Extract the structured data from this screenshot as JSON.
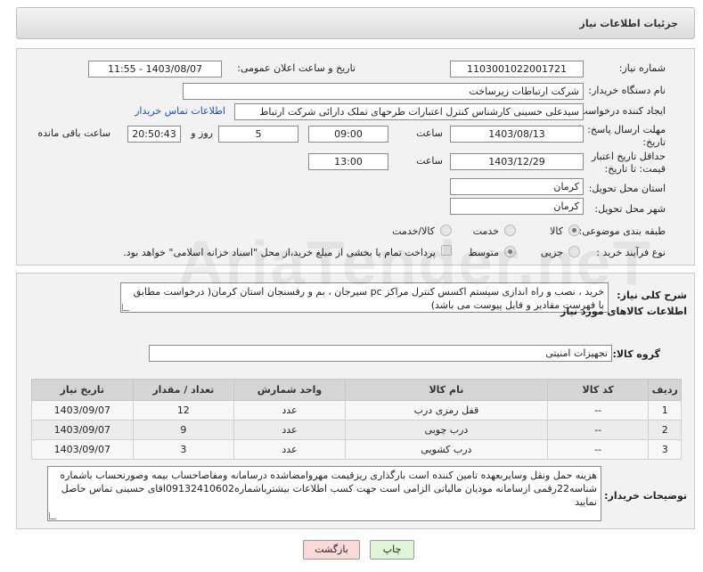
{
  "header": {
    "title": "جزئیات اطلاعات نیاز"
  },
  "form": {
    "need_number": {
      "label": "شماره نیاز:",
      "value": "1103001022001721"
    },
    "announce_datetime": {
      "label": "تاریخ و ساعت اعلان عمومی:",
      "value": "1403/08/07 - 11:55"
    },
    "buyer_org": {
      "label": "نام دستگاه خریدار:",
      "value": "شرکت ارتباطات زیرساخت"
    },
    "requester": {
      "label": "ایجاد کننده درخواست:",
      "value": "سیدعلی حسینی کارشناس کنترل اعتبارات طرحهای تملک دارائی شرکت ارتباط",
      "contact_link": "اطلاعات تماس خریدار"
    },
    "reply_deadline": {
      "label": "مهلت ارسال پاسخ: تا تاریخ:",
      "date": "1403/08/13",
      "time_label": "ساعت",
      "time": "09:00",
      "days": "5",
      "days_label": "روز و",
      "remaining": "20:50:43",
      "remaining_label": "ساعت باقی مانده"
    },
    "price_validity": {
      "label": "حداقل تاریخ اعتبار قیمت: تا تاریخ:",
      "date": "1403/12/29",
      "time_label": "ساعت",
      "time": "13:00"
    },
    "province": {
      "label": "استان محل تحویل:",
      "value": "کرمان"
    },
    "city": {
      "label": "شهر محل تحویل:",
      "value": "کرمان"
    },
    "category": {
      "label": "طبقه بندی موضوعی:",
      "options": [
        "کالا",
        "خدمت",
        "کالا/خدمت"
      ],
      "selected": "کالا"
    },
    "purchase_type": {
      "label": "نوع فرآیند خرید :",
      "options": [
        "جزیی",
        "متوسط"
      ],
      "selected": "متوسط",
      "payment_note": "پرداخت تمام یا بخشی از مبلغ خرید،از محل \"اسناد خزانه اسلامی\" خواهد بود."
    }
  },
  "description": {
    "label": "شرح کلی نیاز:",
    "value": "خرید ، نصب و راه اندازی سیستم اکسس کنترل مراکز pc سیرجان ، بم و رفسنجان استان کرمان( درخواست مطابق با فهرست مقادیر و فایل پیوست می باشد)"
  },
  "goods": {
    "section_title": "اطلاعات کالاهای مورد نیاز",
    "group_label": "گروه کالا:",
    "group_value": "تجهیزات امنیتی",
    "columns": [
      "ردیف",
      "کد کالا",
      "نام کالا",
      "واحد شمارش",
      "تعداد / مقدار",
      "تاریخ نیاز"
    ],
    "rows": [
      {
        "row": "1",
        "code": "--",
        "name": "قفل رمزی درب",
        "unit": "عدد",
        "qty": "12",
        "date": "1403/09/07"
      },
      {
        "row": "2",
        "code": "--",
        "name": "درب چوبی",
        "unit": "عدد",
        "qty": "9",
        "date": "1403/09/07"
      },
      {
        "row": "3",
        "code": "--",
        "name": "درب کشویی",
        "unit": "عدد",
        "qty": "3",
        "date": "1403/09/07"
      }
    ]
  },
  "buyer_notes": {
    "label": "توضیحات خریدار:",
    "value": "هزینه حمل ونقل وسایربعهده تامین کننده است بارگذاری ریزقیمت مهروامضاشده درسامانه ومفاصاحساب بیمه وصورتحساب باشماره شناسه22رقمی ازسامانه مودیان مالیاتی الزامی است جهت کسب اطلاعات بیشترباشماره09132410602اقای حسینی تماس حاصل نمایید"
  },
  "buttons": {
    "print": "چاپ",
    "back": "بازگشت"
  },
  "colors": {
    "link": "#1a55a8",
    "print_bg": "#dff5d8",
    "back_bg": "#fbd9d9"
  },
  "watermark": "AriaTender.neT"
}
